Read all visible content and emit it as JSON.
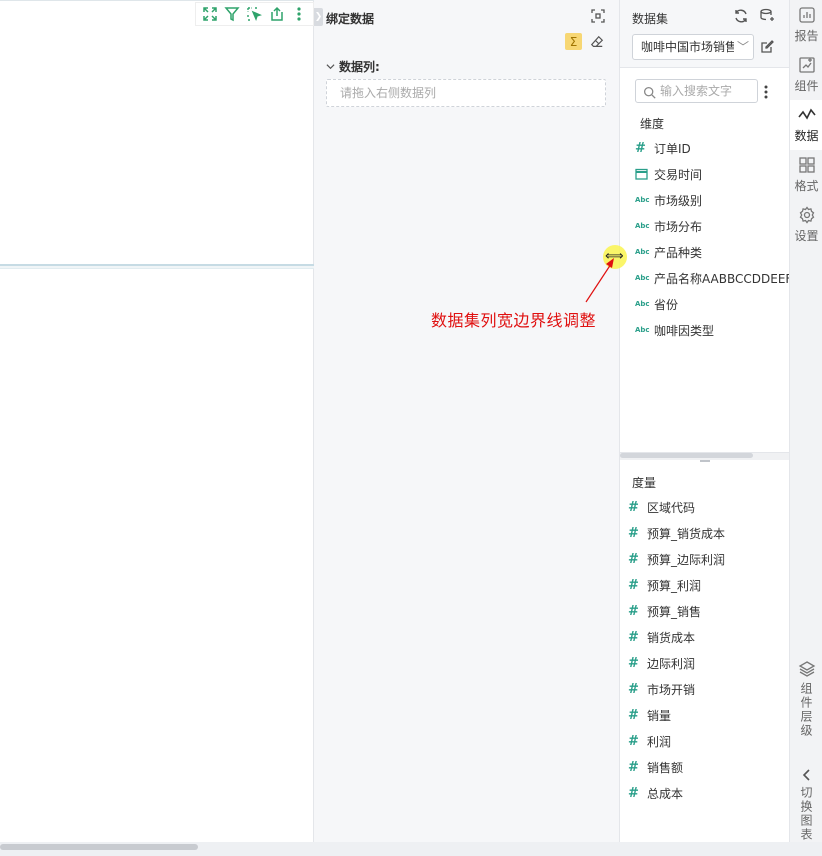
{
  "bind_panel": {
    "title": "绑定数据",
    "sigma": "Σ",
    "section_label": "数据列:",
    "drop_placeholder": "请拖入右侧数据列"
  },
  "dataset_panel": {
    "title": "数据集",
    "selected_dataset": "咖啡中国市场销售",
    "search_placeholder": "输入搜索文字",
    "dimensions_label": "维度",
    "dimensions": [
      {
        "type": "num",
        "label": "订单ID"
      },
      {
        "type": "date",
        "label": "交易时间"
      },
      {
        "type": "abc",
        "label": "市场级别"
      },
      {
        "type": "abc",
        "label": "市场分布"
      },
      {
        "type": "abc",
        "label": "产品种类"
      },
      {
        "type": "abc",
        "label": "产品名称AABBCCDDEEFF"
      },
      {
        "type": "abc",
        "label": "省份"
      },
      {
        "type": "abc",
        "label": "咖啡因类型"
      }
    ],
    "measures_label": "度量",
    "measures": [
      {
        "label": "区域代码"
      },
      {
        "label": "预算_销货成本"
      },
      {
        "label": "预算_边际利润"
      },
      {
        "label": "预算_利润"
      },
      {
        "label": "预算_销售"
      },
      {
        "label": "销货成本"
      },
      {
        "label": "边际利润"
      },
      {
        "label": "市场开销"
      },
      {
        "label": "销量"
      },
      {
        "label": "利润"
      },
      {
        "label": "销售额"
      },
      {
        "label": "总成本"
      }
    ],
    "type_glyphs": {
      "num": "#",
      "abc": "Abc"
    }
  },
  "annotation": {
    "text": "数据集列宽边界线调整",
    "color": "#e01010"
  },
  "tabs": {
    "report": "报告",
    "component": "组件",
    "data": "数据",
    "format": "格式",
    "settings": "设置",
    "layers": "组件层级",
    "switch_chart": "切换图表"
  },
  "colors": {
    "field_icon": "#2a9f8a",
    "toolbar_icon": "#2fa36b",
    "sigma_bg": "#f7d774"
  }
}
